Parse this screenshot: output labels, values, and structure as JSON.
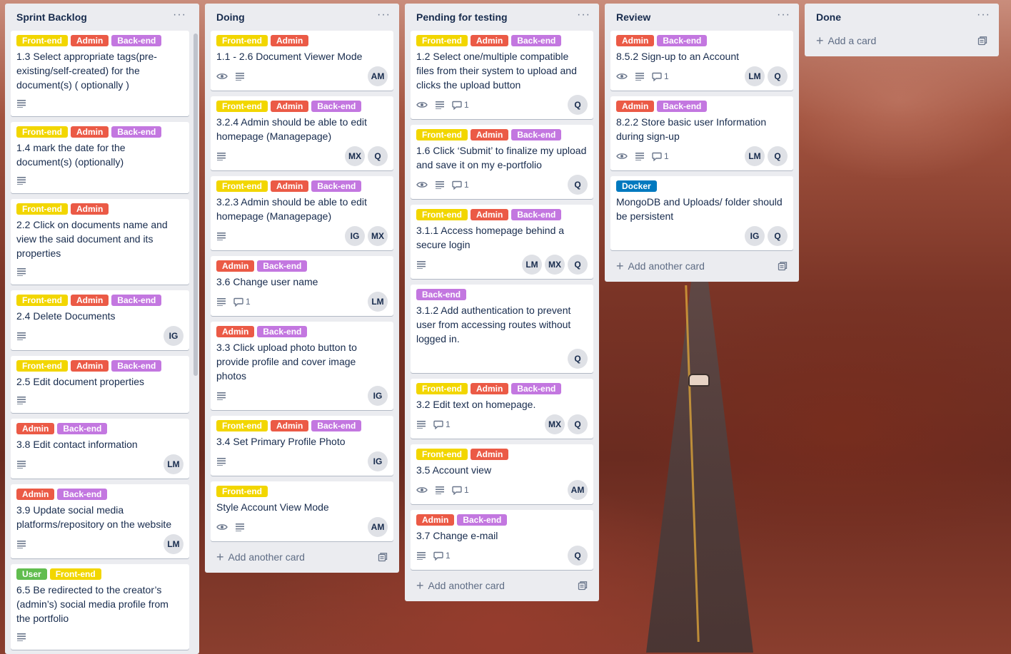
{
  "colors": {
    "front_end": "#f2d600",
    "admin": "#eb5a46",
    "back_end": "#c377e0",
    "user": "#61bd4f",
    "docker": "#0079bf"
  },
  "icons": {
    "watch": "eye-icon",
    "description": "description-icon",
    "comments": "comment-icon",
    "list_menu": "ellipsis-icon",
    "add": "plus-icon",
    "template": "template-icon"
  },
  "lists": [
    {
      "title": "Sprint Backlog",
      "menu": "···",
      "cards": [
        {
          "labels": [
            {
              "text": "Front-end",
              "type": "front_end"
            },
            {
              "text": "Admin",
              "type": "admin"
            },
            {
              "text": "Back-end",
              "type": "back_end"
            }
          ],
          "title": "1.3 Select appropriate tags(pre-existing/self-created) for the document(s) ( optionally )",
          "watch": false,
          "description": true,
          "comments": "",
          "members": []
        },
        {
          "labels": [
            {
              "text": "Front-end",
              "type": "front_end"
            },
            {
              "text": "Admin",
              "type": "admin"
            },
            {
              "text": "Back-end",
              "type": "back_end"
            }
          ],
          "title": "1.4 mark the date for the document(s) (optionally)",
          "watch": false,
          "description": true,
          "comments": "",
          "members": []
        },
        {
          "labels": [
            {
              "text": "Front-end",
              "type": "front_end"
            },
            {
              "text": "Admin",
              "type": "admin"
            }
          ],
          "title": "2.2 Click on documents name and view the said document and its properties",
          "watch": false,
          "description": true,
          "comments": "",
          "members": []
        },
        {
          "labels": [
            {
              "text": "Front-end",
              "type": "front_end"
            },
            {
              "text": "Admin",
              "type": "admin"
            },
            {
              "text": "Back-end",
              "type": "back_end"
            }
          ],
          "title": "2.4 Delete Documents",
          "watch": false,
          "description": true,
          "comments": "",
          "members": [
            "IG"
          ]
        },
        {
          "labels": [
            {
              "text": "Front-end",
              "type": "front_end"
            },
            {
              "text": "Admin",
              "type": "admin"
            },
            {
              "text": "Back-end",
              "type": "back_end"
            }
          ],
          "title": "2.5 Edit document properties",
          "watch": false,
          "description": true,
          "comments": "",
          "members": []
        },
        {
          "labels": [
            {
              "text": "Admin",
              "type": "admin"
            },
            {
              "text": "Back-end",
              "type": "back_end"
            }
          ],
          "title": "3.8 Edit contact information",
          "watch": false,
          "description": true,
          "comments": "",
          "members": [
            "LM"
          ]
        },
        {
          "labels": [
            {
              "text": "Admin",
              "type": "admin"
            },
            {
              "text": "Back-end",
              "type": "back_end"
            }
          ],
          "title": "3.9 Update social media platforms/repository on the website",
          "watch": false,
          "description": true,
          "comments": "",
          "members": [
            "LM"
          ]
        },
        {
          "labels": [
            {
              "text": "User",
              "type": "user"
            },
            {
              "text": "Front-end",
              "type": "front_end"
            }
          ],
          "title": "6.5 Be redirected to the creator’s (admin’s) social media profile from the portfolio",
          "watch": false,
          "description": true,
          "comments": "",
          "members": []
        }
      ]
    },
    {
      "title": "Doing",
      "menu": "···",
      "add_label": "Add another card",
      "cards": [
        {
          "labels": [
            {
              "text": "Front-end",
              "type": "front_end"
            },
            {
              "text": "Admin",
              "type": "admin"
            }
          ],
          "title": "1.1 - 2.6 Document Viewer Mode",
          "watch": true,
          "description": true,
          "comments": "",
          "members": [
            "AM"
          ]
        },
        {
          "labels": [
            {
              "text": "Front-end",
              "type": "front_end"
            },
            {
              "text": "Admin",
              "type": "admin"
            },
            {
              "text": "Back-end",
              "type": "back_end"
            }
          ],
          "title": "3.2.4 Admin should be able to edit homepage (Managepage)",
          "watch": false,
          "description": true,
          "comments": "",
          "members": [
            "MX",
            "Q"
          ]
        },
        {
          "labels": [
            {
              "text": "Front-end",
              "type": "front_end"
            },
            {
              "text": "Admin",
              "type": "admin"
            },
            {
              "text": "Back-end",
              "type": "back_end"
            }
          ],
          "title": "3.2.3 Admin should be able to edit homepage (Managepage)",
          "watch": false,
          "description": true,
          "comments": "",
          "members": [
            "IG",
            "MX"
          ]
        },
        {
          "labels": [
            {
              "text": "Admin",
              "type": "admin"
            },
            {
              "text": "Back-end",
              "type": "back_end"
            }
          ],
          "title": "3.6 Change user name",
          "watch": false,
          "description": true,
          "comments": "1",
          "members": [
            "LM"
          ]
        },
        {
          "labels": [
            {
              "text": "Admin",
              "type": "admin"
            },
            {
              "text": "Back-end",
              "type": "back_end"
            }
          ],
          "title": "3.3 Click upload photo button to provide profile and cover image photos",
          "watch": false,
          "description": true,
          "comments": "",
          "members": [
            "IG"
          ]
        },
        {
          "labels": [
            {
              "text": "Front-end",
              "type": "front_end"
            },
            {
              "text": "Admin",
              "type": "admin"
            },
            {
              "text": "Back-end",
              "type": "back_end"
            }
          ],
          "title": "3.4 Set Primary Profile Photo",
          "watch": false,
          "description": true,
          "comments": "",
          "members": [
            "IG"
          ]
        },
        {
          "labels": [
            {
              "text": "Front-end",
              "type": "front_end"
            }
          ],
          "title": "Style Account View Mode",
          "watch": true,
          "description": true,
          "comments": "",
          "members": [
            "AM"
          ]
        }
      ]
    },
    {
      "title": "Pending for testing",
      "menu": "···",
      "add_label": "Add another card",
      "cards": [
        {
          "labels": [
            {
              "text": "Front-end",
              "type": "front_end"
            },
            {
              "text": "Admin",
              "type": "admin"
            },
            {
              "text": "Back-end",
              "type": "back_end"
            }
          ],
          "title": "1.2 Select one/multiple compatible files from their system to upload and clicks the upload button",
          "watch": true,
          "description": true,
          "comments": "1",
          "members": [
            "Q"
          ]
        },
        {
          "labels": [
            {
              "text": "Front-end",
              "type": "front_end"
            },
            {
              "text": "Admin",
              "type": "admin"
            },
            {
              "text": "Back-end",
              "type": "back_end"
            }
          ],
          "title": "1.6 Click ‘Submit’ to finalize my upload and save it on my e-portfolio",
          "watch": true,
          "description": true,
          "comments": "1",
          "members": [
            "Q"
          ]
        },
        {
          "labels": [
            {
              "text": "Front-end",
              "type": "front_end"
            },
            {
              "text": "Admin",
              "type": "admin"
            },
            {
              "text": "Back-end",
              "type": "back_end"
            }
          ],
          "title": "3.1.1 Access homepage behind a secure login",
          "watch": false,
          "description": true,
          "comments": "",
          "members": [
            "LM",
            "MX",
            "Q"
          ]
        },
        {
          "labels": [
            {
              "text": "Back-end",
              "type": "back_end"
            }
          ],
          "title": "3.1.2 Add authentication to prevent user from accessing routes without logged in.",
          "watch": false,
          "description": false,
          "comments": "",
          "members": [
            "Q"
          ]
        },
        {
          "labels": [
            {
              "text": "Front-end",
              "type": "front_end"
            },
            {
              "text": "Admin",
              "type": "admin"
            },
            {
              "text": "Back-end",
              "type": "back_end"
            }
          ],
          "title": "3.2 Edit text on homepage.",
          "watch": false,
          "description": true,
          "comments": "1",
          "members": [
            "MX",
            "Q"
          ]
        },
        {
          "labels": [
            {
              "text": "Front-end",
              "type": "front_end"
            },
            {
              "text": "Admin",
              "type": "admin"
            }
          ],
          "title": "3.5 Account view",
          "watch": true,
          "description": true,
          "comments": "1",
          "members": [
            "AM"
          ]
        },
        {
          "labels": [
            {
              "text": "Admin",
              "type": "admin"
            },
            {
              "text": "Back-end",
              "type": "back_end"
            }
          ],
          "title": "3.7 Change e-mail",
          "watch": false,
          "description": true,
          "comments": "1",
          "members": [
            "Q"
          ]
        }
      ]
    },
    {
      "title": "Review",
      "menu": "···",
      "add_label": "Add another card",
      "cards": [
        {
          "labels": [
            {
              "text": "Admin",
              "type": "admin"
            },
            {
              "text": "Back-end",
              "type": "back_end"
            }
          ],
          "title": "8.5.2 Sign-up to an Account",
          "watch": true,
          "description": true,
          "comments": "1",
          "members": [
            "LM",
            "Q"
          ]
        },
        {
          "labels": [
            {
              "text": "Admin",
              "type": "admin"
            },
            {
              "text": "Back-end",
              "type": "back_end"
            }
          ],
          "title": "8.2.2 Store basic user Information during sign-up",
          "watch": true,
          "description": true,
          "comments": "1",
          "members": [
            "LM",
            "Q"
          ]
        },
        {
          "labels": [
            {
              "text": "Docker",
              "type": "docker"
            }
          ],
          "title": "MongoDB and Uploads/ folder should be persistent",
          "watch": false,
          "description": false,
          "comments": "",
          "members": [
            "IG",
            "Q"
          ]
        }
      ]
    },
    {
      "title": "Done",
      "menu": "···",
      "add_label": "Add a card",
      "cards": []
    }
  ]
}
